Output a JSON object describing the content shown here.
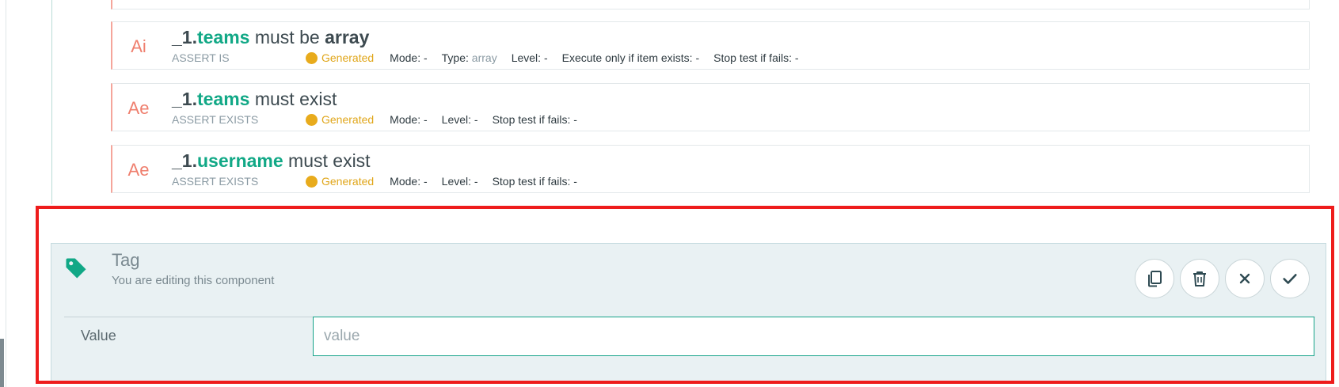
{
  "asserts": [
    {
      "code": "Ai",
      "path": "_1.",
      "field": "teams",
      "rest": " must be ",
      "bold_suffix": "array",
      "type": "ASSERT IS",
      "generated": "Generated",
      "meta": [
        {
          "label": "Mode:",
          "value": " -"
        },
        {
          "label": "Type:",
          "value": " array"
        },
        {
          "label": "Level:",
          "value": " -"
        },
        {
          "label": "Execute only if item exists:",
          "value": " -"
        },
        {
          "label": "Stop test if fails:",
          "value": " -"
        }
      ]
    },
    {
      "code": "Ae",
      "path": "_1.",
      "field": "teams",
      "rest": " must exist",
      "type": "ASSERT EXISTS",
      "generated": "Generated",
      "meta": [
        {
          "label": "Mode:",
          "value": " -"
        },
        {
          "label": "Level:",
          "value": " -"
        },
        {
          "label": "Stop test if fails:",
          "value": " -"
        }
      ]
    },
    {
      "code": "Ae",
      "path": "_1.",
      "field": "username",
      "rest": " must exist",
      "type": "ASSERT EXISTS",
      "generated": "Generated",
      "meta": [
        {
          "label": "Mode:",
          "value": " -"
        },
        {
          "label": "Level:",
          "value": " -"
        },
        {
          "label": "Stop test if fails:",
          "value": " -"
        }
      ]
    }
  ],
  "tag_editor": {
    "title": "Tag",
    "subtitle": "You are editing this component",
    "icon": "tag-icon",
    "actions": [
      "copy-icon",
      "trash-icon",
      "close-icon",
      "check-icon"
    ],
    "value_label": "Value",
    "value": "",
    "placeholder": "value"
  },
  "colors": {
    "accent": "#11a886",
    "assert_code": "#ef7f6e",
    "generated": "#e8ab1c",
    "highlight": "#ee1c1c",
    "editor_bg": "#e9f1f3"
  }
}
